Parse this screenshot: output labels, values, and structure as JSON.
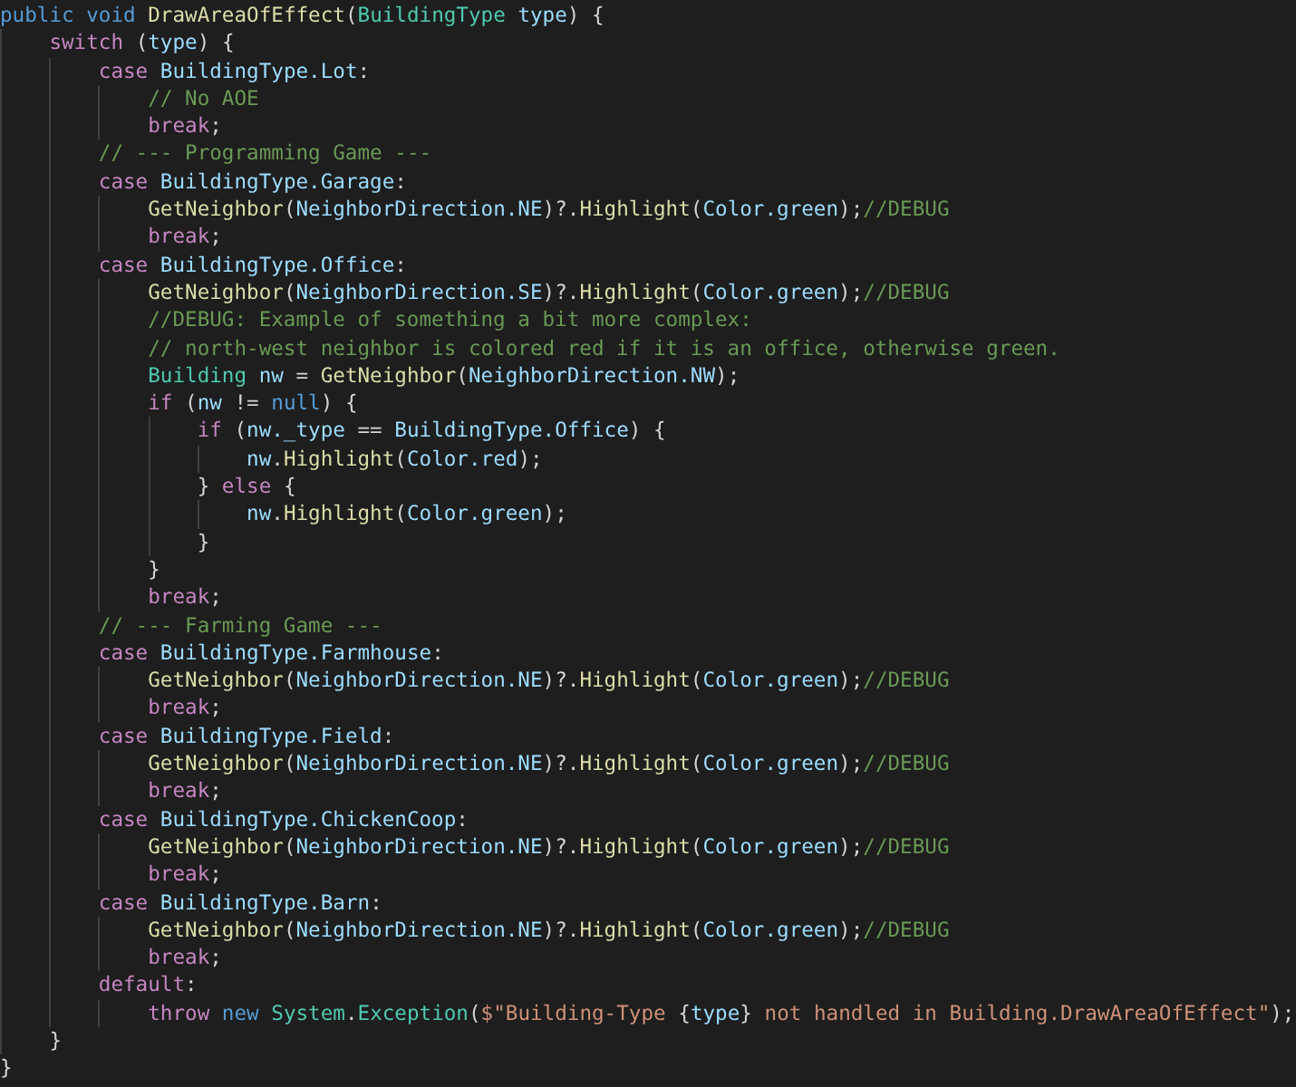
{
  "code_lines": [
    {
      "tokens": [
        {
          "kind": "storage",
          "text": "public void"
        },
        {
          "kind": "func",
          "text": " DrawAreaOfEffect"
        },
        {
          "kind": "plain",
          "text": "("
        },
        {
          "kind": "type",
          "text": "BuildingType"
        },
        {
          "kind": "var",
          "text": " type"
        },
        {
          "kind": "plain",
          "text": ") {"
        }
      ],
      "children": [
        {
          "tokens": [
            {
              "kind": "kw",
              "text": "switch"
            },
            {
              "kind": "plain",
              "text": " ("
            },
            {
              "kind": "var",
              "text": "type"
            },
            {
              "kind": "plain",
              "text": ") {"
            }
          ],
          "children": [
            {
              "tokens": [
                {
                  "kind": "kw",
                  "text": "case"
                },
                {
                  "kind": "var",
                  "text": " BuildingType.Lot"
                },
                {
                  "kind": "plain",
                  "text": ":"
                }
              ],
              "children": [
                {
                  "tokens": [
                    {
                      "kind": "comment",
                      "text": "// No AOE"
                    }
                  ]
                },
                {
                  "tokens": [
                    {
                      "kind": "kw",
                      "text": "break"
                    },
                    {
                      "kind": "plain",
                      "text": ";"
                    }
                  ]
                }
              ]
            },
            {
              "tokens": [
                {
                  "kind": "comment",
                  "text": "// --- Programming Game ---"
                }
              ]
            },
            {
              "tokens": [
                {
                  "kind": "kw",
                  "text": "case"
                },
                {
                  "kind": "var",
                  "text": " BuildingType.Garage"
                },
                {
                  "kind": "plain",
                  "text": ":"
                }
              ],
              "children": [
                {
                  "tokens": [
                    {
                      "kind": "func",
                      "text": "GetNeighbor"
                    },
                    {
                      "kind": "plain",
                      "text": "("
                    },
                    {
                      "kind": "var",
                      "text": "NeighborDirection.NE"
                    },
                    {
                      "kind": "plain",
                      "text": ")?."
                    },
                    {
                      "kind": "func",
                      "text": "Highlight"
                    },
                    {
                      "kind": "plain",
                      "text": "("
                    },
                    {
                      "kind": "var",
                      "text": "Color.green"
                    },
                    {
                      "kind": "plain",
                      "text": ");"
                    },
                    {
                      "kind": "comment",
                      "text": "//DEBUG"
                    }
                  ]
                },
                {
                  "tokens": [
                    {
                      "kind": "kw",
                      "text": "break"
                    },
                    {
                      "kind": "plain",
                      "text": ";"
                    }
                  ]
                }
              ]
            },
            {
              "tokens": [
                {
                  "kind": "kw",
                  "text": "case"
                },
                {
                  "kind": "var",
                  "text": " BuildingType.Office"
                },
                {
                  "kind": "plain",
                  "text": ":"
                }
              ],
              "children": [
                {
                  "tokens": [
                    {
                      "kind": "func",
                      "text": "GetNeighbor"
                    },
                    {
                      "kind": "plain",
                      "text": "("
                    },
                    {
                      "kind": "var",
                      "text": "NeighborDirection.SE"
                    },
                    {
                      "kind": "plain",
                      "text": ")?."
                    },
                    {
                      "kind": "func",
                      "text": "Highlight"
                    },
                    {
                      "kind": "plain",
                      "text": "("
                    },
                    {
                      "kind": "var",
                      "text": "Color.green"
                    },
                    {
                      "kind": "plain",
                      "text": ");"
                    },
                    {
                      "kind": "comment",
                      "text": "//DEBUG"
                    }
                  ]
                },
                {
                  "tokens": [
                    {
                      "kind": "comment",
                      "text": "//DEBUG: Example of something a bit more complex:"
                    }
                  ]
                },
                {
                  "tokens": [
                    {
                      "kind": "comment",
                      "text": "// north-west neighbor is colored red if it is an office, otherwise green."
                    }
                  ]
                },
                {
                  "tokens": [
                    {
                      "kind": "type",
                      "text": "Building"
                    },
                    {
                      "kind": "var",
                      "text": " nw"
                    },
                    {
                      "kind": "plain",
                      "text": " = "
                    },
                    {
                      "kind": "func",
                      "text": "GetNeighbor"
                    },
                    {
                      "kind": "plain",
                      "text": "("
                    },
                    {
                      "kind": "var",
                      "text": "NeighborDirection.NW"
                    },
                    {
                      "kind": "plain",
                      "text": ");"
                    }
                  ]
                },
                {
                  "tokens": [
                    {
                      "kind": "kw",
                      "text": "if"
                    },
                    {
                      "kind": "plain",
                      "text": " ("
                    },
                    {
                      "kind": "var",
                      "text": "nw"
                    },
                    {
                      "kind": "plain",
                      "text": " != "
                    },
                    {
                      "kind": "storage",
                      "text": "null"
                    },
                    {
                      "kind": "plain",
                      "text": ") {"
                    }
                  ],
                  "children": [
                    {
                      "tokens": [
                        {
                          "kind": "kw",
                          "text": "if"
                        },
                        {
                          "kind": "plain",
                          "text": " ("
                        },
                        {
                          "kind": "var",
                          "text": "nw._type"
                        },
                        {
                          "kind": "plain",
                          "text": " == "
                        },
                        {
                          "kind": "var",
                          "text": "BuildingType.Office"
                        },
                        {
                          "kind": "plain",
                          "text": ") {"
                        }
                      ],
                      "children": [
                        {
                          "tokens": [
                            {
                              "kind": "var",
                              "text": "nw"
                            },
                            {
                              "kind": "plain",
                              "text": "."
                            },
                            {
                              "kind": "func",
                              "text": "Highlight"
                            },
                            {
                              "kind": "plain",
                              "text": "("
                            },
                            {
                              "kind": "var",
                              "text": "Color.red"
                            },
                            {
                              "kind": "plain",
                              "text": ");"
                            }
                          ]
                        }
                      ]
                    },
                    {
                      "tokens": [
                        {
                          "kind": "plain",
                          "text": "} "
                        },
                        {
                          "kind": "kw",
                          "text": "else"
                        },
                        {
                          "kind": "plain",
                          "text": " {"
                        }
                      ],
                      "children": [
                        {
                          "tokens": [
                            {
                              "kind": "var",
                              "text": "nw"
                            },
                            {
                              "kind": "plain",
                              "text": "."
                            },
                            {
                              "kind": "func",
                              "text": "Highlight"
                            },
                            {
                              "kind": "plain",
                              "text": "("
                            },
                            {
                              "kind": "var",
                              "text": "Color.green"
                            },
                            {
                              "kind": "plain",
                              "text": ");"
                            }
                          ]
                        }
                      ]
                    },
                    {
                      "tokens": [
                        {
                          "kind": "plain",
                          "text": "}"
                        }
                      ]
                    }
                  ]
                },
                {
                  "tokens": [
                    {
                      "kind": "plain",
                      "text": "}"
                    }
                  ]
                },
                {
                  "tokens": [
                    {
                      "kind": "kw",
                      "text": "break"
                    },
                    {
                      "kind": "plain",
                      "text": ";"
                    }
                  ]
                }
              ]
            },
            {
              "tokens": [
                {
                  "kind": "comment",
                  "text": "// --- Farming Game ---"
                }
              ]
            },
            {
              "tokens": [
                {
                  "kind": "kw",
                  "text": "case"
                },
                {
                  "kind": "var",
                  "text": " BuildingType.Farmhouse"
                },
                {
                  "kind": "plain",
                  "text": ":"
                }
              ],
              "children": [
                {
                  "tokens": [
                    {
                      "kind": "func",
                      "text": "GetNeighbor"
                    },
                    {
                      "kind": "plain",
                      "text": "("
                    },
                    {
                      "kind": "var",
                      "text": "NeighborDirection.NE"
                    },
                    {
                      "kind": "plain",
                      "text": ")?."
                    },
                    {
                      "kind": "func",
                      "text": "Highlight"
                    },
                    {
                      "kind": "plain",
                      "text": "("
                    },
                    {
                      "kind": "var",
                      "text": "Color.green"
                    },
                    {
                      "kind": "plain",
                      "text": ");"
                    },
                    {
                      "kind": "comment",
                      "text": "//DEBUG"
                    }
                  ]
                },
                {
                  "tokens": [
                    {
                      "kind": "kw",
                      "text": "break"
                    },
                    {
                      "kind": "plain",
                      "text": ";"
                    }
                  ]
                }
              ]
            },
            {
              "tokens": [
                {
                  "kind": "kw",
                  "text": "case"
                },
                {
                  "kind": "var",
                  "text": " BuildingType.Field"
                },
                {
                  "kind": "plain",
                  "text": ":"
                }
              ],
              "children": [
                {
                  "tokens": [
                    {
                      "kind": "func",
                      "text": "GetNeighbor"
                    },
                    {
                      "kind": "plain",
                      "text": "("
                    },
                    {
                      "kind": "var",
                      "text": "NeighborDirection.NE"
                    },
                    {
                      "kind": "plain",
                      "text": ")?."
                    },
                    {
                      "kind": "func",
                      "text": "Highlight"
                    },
                    {
                      "kind": "plain",
                      "text": "("
                    },
                    {
                      "kind": "var",
                      "text": "Color.green"
                    },
                    {
                      "kind": "plain",
                      "text": ");"
                    },
                    {
                      "kind": "comment",
                      "text": "//DEBUG"
                    }
                  ]
                },
                {
                  "tokens": [
                    {
                      "kind": "kw",
                      "text": "break"
                    },
                    {
                      "kind": "plain",
                      "text": ";"
                    }
                  ]
                }
              ]
            },
            {
              "tokens": [
                {
                  "kind": "kw",
                  "text": "case"
                },
                {
                  "kind": "var",
                  "text": " BuildingType.ChickenCoop"
                },
                {
                  "kind": "plain",
                  "text": ":"
                }
              ],
              "children": [
                {
                  "tokens": [
                    {
                      "kind": "func",
                      "text": "GetNeighbor"
                    },
                    {
                      "kind": "plain",
                      "text": "("
                    },
                    {
                      "kind": "var",
                      "text": "NeighborDirection.NE"
                    },
                    {
                      "kind": "plain",
                      "text": ")?."
                    },
                    {
                      "kind": "func",
                      "text": "Highlight"
                    },
                    {
                      "kind": "plain",
                      "text": "("
                    },
                    {
                      "kind": "var",
                      "text": "Color.green"
                    },
                    {
                      "kind": "plain",
                      "text": ");"
                    },
                    {
                      "kind": "comment",
                      "text": "//DEBUG"
                    }
                  ]
                },
                {
                  "tokens": [
                    {
                      "kind": "kw",
                      "text": "break"
                    },
                    {
                      "kind": "plain",
                      "text": ";"
                    }
                  ]
                }
              ]
            },
            {
              "tokens": [
                {
                  "kind": "kw",
                  "text": "case"
                },
                {
                  "kind": "var",
                  "text": " BuildingType.Barn"
                },
                {
                  "kind": "plain",
                  "text": ":"
                }
              ],
              "children": [
                {
                  "tokens": [
                    {
                      "kind": "func",
                      "text": "GetNeighbor"
                    },
                    {
                      "kind": "plain",
                      "text": "("
                    },
                    {
                      "kind": "var",
                      "text": "NeighborDirection.NE"
                    },
                    {
                      "kind": "plain",
                      "text": ")?."
                    },
                    {
                      "kind": "func",
                      "text": "Highlight"
                    },
                    {
                      "kind": "plain",
                      "text": "("
                    },
                    {
                      "kind": "var",
                      "text": "Color.green"
                    },
                    {
                      "kind": "plain",
                      "text": ");"
                    },
                    {
                      "kind": "comment",
                      "text": "//DEBUG"
                    }
                  ]
                },
                {
                  "tokens": [
                    {
                      "kind": "kw",
                      "text": "break"
                    },
                    {
                      "kind": "plain",
                      "text": ";"
                    }
                  ]
                }
              ]
            },
            {
              "tokens": [
                {
                  "kind": "kw",
                  "text": "default"
                },
                {
                  "kind": "plain",
                  "text": ":"
                }
              ],
              "children": [
                {
                  "tokens": [
                    {
                      "kind": "kw",
                      "text": "throw"
                    },
                    {
                      "kind": "storage",
                      "text": " new"
                    },
                    {
                      "kind": "type",
                      "text": " System"
                    },
                    {
                      "kind": "plain",
                      "text": "."
                    },
                    {
                      "kind": "type",
                      "text": "Exception"
                    },
                    {
                      "kind": "plain",
                      "text": "("
                    },
                    {
                      "kind": "string",
                      "text": "$\"Building-Type "
                    },
                    {
                      "kind": "plain",
                      "text": "{"
                    },
                    {
                      "kind": "var",
                      "text": "type"
                    },
                    {
                      "kind": "plain",
                      "text": "}"
                    },
                    {
                      "kind": "string",
                      "text": " not handled in Building.DrawAreaOfEffect\""
                    },
                    {
                      "kind": "plain",
                      "text": ");"
                    }
                  ]
                }
              ]
            }
          ]
        },
        {
          "tokens": [
            {
              "kind": "plain",
              "text": "}"
            }
          ]
        }
      ]
    },
    {
      "tokens": [
        {
          "kind": "plain",
          "text": "}"
        }
      ]
    }
  ]
}
